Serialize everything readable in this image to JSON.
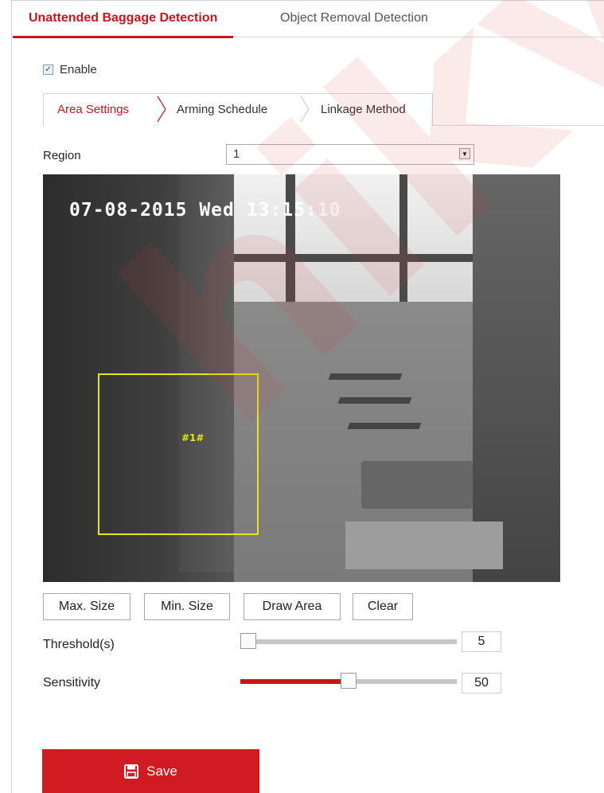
{
  "tabs": {
    "main": [
      {
        "label": "Unattended Baggage Detection",
        "active": true
      },
      {
        "label": "Object Removal Detection",
        "active": false
      }
    ],
    "sub": [
      {
        "label": "Area Settings",
        "active": true
      },
      {
        "label": "Arming Schedule",
        "active": false
      },
      {
        "label": "Linkage Method",
        "active": false
      }
    ]
  },
  "enable": {
    "label": "Enable",
    "checked": true
  },
  "region": {
    "label": "Region",
    "value": "1"
  },
  "video": {
    "timestamp": "07-08-2015 Wed 13:15:10",
    "area_label": "#1#"
  },
  "buttons": {
    "max_size": "Max. Size",
    "min_size": "Min. Size",
    "draw_area": "Draw Area",
    "clear": "Clear",
    "save": "Save"
  },
  "threshold": {
    "label": "Threshold(s)",
    "value": "5",
    "fraction": 0.0
  },
  "sensitivity": {
    "label": "Sensitivity",
    "value": "50",
    "fraction": 0.5
  },
  "watermark": "hikvision.net",
  "colors": {
    "accent": "#c8161d",
    "detect_box": "#e6e619"
  }
}
